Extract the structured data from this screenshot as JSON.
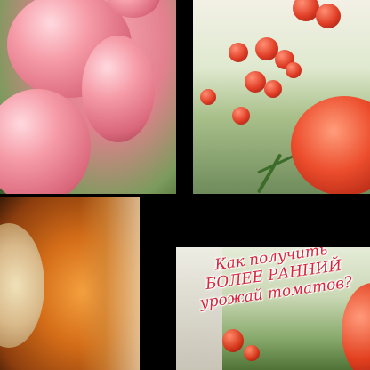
{
  "collage": {
    "ad_caption": {
      "line1": "Как получить",
      "line2": "БОЛЕЕ РАННИЙ",
      "line3": "урожай томатов?"
    }
  },
  "colors": {
    "background": "#000000",
    "caption_text": "#d7263d",
    "pink_tomato": "#e4808f",
    "red_tomato": "#e03d25",
    "pumpkin": "#d46d18"
  }
}
